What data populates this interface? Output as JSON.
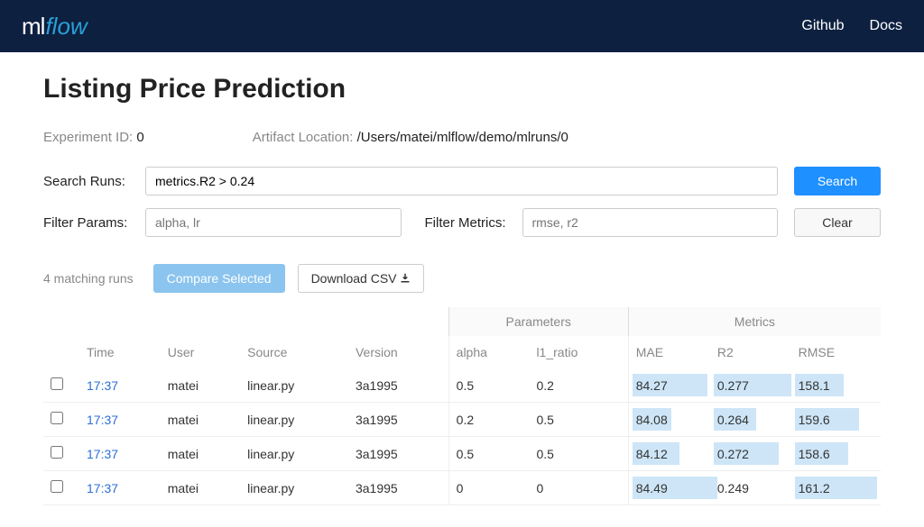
{
  "nav": {
    "github": "Github",
    "docs": "Docs"
  },
  "title": "Listing Price Prediction",
  "experiment": {
    "id_label": "Experiment ID:",
    "id_value": "0",
    "artifact_label": "Artifact Location:",
    "artifact_value": "/Users/matei/mlflow/demo/mlruns/0"
  },
  "search": {
    "label": "Search Runs:",
    "value": "metrics.R2 > 0.24",
    "button": "Search"
  },
  "filters": {
    "params_label": "Filter Params:",
    "params_placeholder": "alpha, lr",
    "metrics_label": "Filter Metrics:",
    "metrics_placeholder": "rmse, r2",
    "clear_button": "Clear"
  },
  "actions": {
    "match_count": "4 matching runs",
    "compare": "Compare Selected",
    "download": "Download CSV"
  },
  "table": {
    "group_params": "Parameters",
    "group_metrics": "Metrics",
    "headers": {
      "time": "Time",
      "user": "User",
      "source": "Source",
      "version": "Version",
      "alpha": "alpha",
      "l1_ratio": "l1_ratio",
      "mae": "MAE",
      "r2": "R2",
      "rmse": "RMSE"
    },
    "rows": [
      {
        "time": "17:37",
        "user": "matei",
        "source": "linear.py",
        "version": "3a1995",
        "alpha": "0.5",
        "l1_ratio": "0.2",
        "mae": "84.27",
        "r2": "0.277",
        "rmse": "158.1",
        "bars": {
          "mae": 92,
          "r2": 96,
          "rmse": 55
        }
      },
      {
        "time": "17:37",
        "user": "matei",
        "source": "linear.py",
        "version": "3a1995",
        "alpha": "0.2",
        "l1_ratio": "0.5",
        "mae": "84.08",
        "r2": "0.264",
        "rmse": "159.6",
        "bars": {
          "mae": 48,
          "r2": 53,
          "rmse": 72
        }
      },
      {
        "time": "17:37",
        "user": "matei",
        "source": "linear.py",
        "version": "3a1995",
        "alpha": "0.5",
        "l1_ratio": "0.5",
        "mae": "84.12",
        "r2": "0.272",
        "rmse": "158.6",
        "bars": {
          "mae": 58,
          "r2": 80,
          "rmse": 60
        }
      },
      {
        "time": "17:37",
        "user": "matei",
        "source": "linear.py",
        "version": "3a1995",
        "alpha": "0",
        "l1_ratio": "0",
        "mae": "84.49",
        "r2": "0.249",
        "rmse": "161.2",
        "bars": {
          "mae": 100,
          "r2": 5,
          "rmse": 92
        }
      }
    ]
  }
}
